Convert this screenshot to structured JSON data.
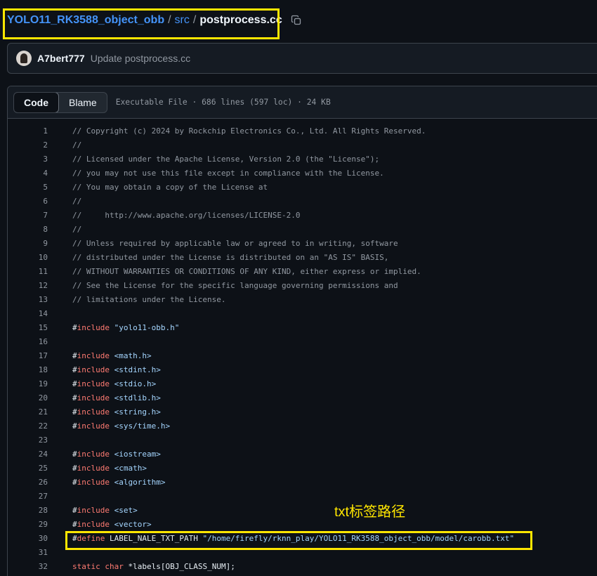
{
  "breadcrumb": {
    "repo": "YOLO11_RK3588_object_obb",
    "sep1": "/",
    "folder": "src",
    "sep2": "/",
    "file": "postprocess.cc"
  },
  "commit": {
    "author": "A7bert777",
    "message": "Update postprocess.cc"
  },
  "file_header": {
    "tab_code": "Code",
    "tab_blame": "Blame",
    "meta": "Executable File · 686 lines (597 loc) · 24 KB"
  },
  "code_lines": [
    {
      "n": "1",
      "t": [
        {
          "c": "c",
          "v": "// Copyright (c) 2024 by Rockchip Electronics Co., Ltd. All Rights Reserved."
        }
      ]
    },
    {
      "n": "2",
      "t": [
        {
          "c": "c",
          "v": "//"
        }
      ]
    },
    {
      "n": "3",
      "t": [
        {
          "c": "c",
          "v": "// Licensed under the Apache License, Version 2.0 (the \"License\");"
        }
      ]
    },
    {
      "n": "4",
      "t": [
        {
          "c": "c",
          "v": "// you may not use this file except in compliance with the License."
        }
      ]
    },
    {
      "n": "5",
      "t": [
        {
          "c": "c",
          "v": "// You may obtain a copy of the License at"
        }
      ]
    },
    {
      "n": "6",
      "t": [
        {
          "c": "c",
          "v": "//"
        }
      ]
    },
    {
      "n": "7",
      "t": [
        {
          "c": "c",
          "v": "//     http://www.apache.org/licenses/LICENSE-2.0"
        }
      ]
    },
    {
      "n": "8",
      "t": [
        {
          "c": "c",
          "v": "//"
        }
      ]
    },
    {
      "n": "9",
      "t": [
        {
          "c": "c",
          "v": "// Unless required by applicable law or agreed to in writing, software"
        }
      ]
    },
    {
      "n": "10",
      "t": [
        {
          "c": "c",
          "v": "// distributed under the License is distributed on an \"AS IS\" BASIS,"
        }
      ]
    },
    {
      "n": "11",
      "t": [
        {
          "c": "c",
          "v": "// WITHOUT WARRANTIES OR CONDITIONS OF ANY KIND, either express or implied."
        }
      ]
    },
    {
      "n": "12",
      "t": [
        {
          "c": "c",
          "v": "// See the License for the specific language governing permissions and"
        }
      ]
    },
    {
      "n": "13",
      "t": [
        {
          "c": "c",
          "v": "// limitations under the License."
        }
      ]
    },
    {
      "n": "14",
      "t": []
    },
    {
      "n": "15",
      "t": [
        {
          "c": "",
          "v": "#"
        },
        {
          "c": "k",
          "v": "include"
        },
        {
          "c": "",
          "v": " "
        },
        {
          "c": "s",
          "v": "\"yolo11-obb.h\""
        }
      ]
    },
    {
      "n": "16",
      "t": []
    },
    {
      "n": "17",
      "t": [
        {
          "c": "",
          "v": "#"
        },
        {
          "c": "k",
          "v": "include"
        },
        {
          "c": "",
          "v": " "
        },
        {
          "c": "s",
          "v": "<math.h>"
        }
      ]
    },
    {
      "n": "18",
      "t": [
        {
          "c": "",
          "v": "#"
        },
        {
          "c": "k",
          "v": "include"
        },
        {
          "c": "",
          "v": " "
        },
        {
          "c": "s",
          "v": "<stdint.h>"
        }
      ]
    },
    {
      "n": "19",
      "t": [
        {
          "c": "",
          "v": "#"
        },
        {
          "c": "k",
          "v": "include"
        },
        {
          "c": "",
          "v": " "
        },
        {
          "c": "s",
          "v": "<stdio.h>"
        }
      ]
    },
    {
      "n": "20",
      "t": [
        {
          "c": "",
          "v": "#"
        },
        {
          "c": "k",
          "v": "include"
        },
        {
          "c": "",
          "v": " "
        },
        {
          "c": "s",
          "v": "<stdlib.h>"
        }
      ]
    },
    {
      "n": "21",
      "t": [
        {
          "c": "",
          "v": "#"
        },
        {
          "c": "k",
          "v": "include"
        },
        {
          "c": "",
          "v": " "
        },
        {
          "c": "s",
          "v": "<string.h>"
        }
      ]
    },
    {
      "n": "22",
      "t": [
        {
          "c": "",
          "v": "#"
        },
        {
          "c": "k",
          "v": "include"
        },
        {
          "c": "",
          "v": " "
        },
        {
          "c": "s",
          "v": "<sys/time.h>"
        }
      ]
    },
    {
      "n": "23",
      "t": []
    },
    {
      "n": "24",
      "t": [
        {
          "c": "",
          "v": "#"
        },
        {
          "c": "k",
          "v": "include"
        },
        {
          "c": "",
          "v": " "
        },
        {
          "c": "s",
          "v": "<iostream>"
        }
      ]
    },
    {
      "n": "25",
      "t": [
        {
          "c": "",
          "v": "#"
        },
        {
          "c": "k",
          "v": "include"
        },
        {
          "c": "",
          "v": " "
        },
        {
          "c": "s",
          "v": "<cmath>"
        }
      ]
    },
    {
      "n": "26",
      "t": [
        {
          "c": "",
          "v": "#"
        },
        {
          "c": "k",
          "v": "include"
        },
        {
          "c": "",
          "v": " "
        },
        {
          "c": "s",
          "v": "<algorithm>"
        }
      ]
    },
    {
      "n": "27",
      "t": []
    },
    {
      "n": "28",
      "t": [
        {
          "c": "",
          "v": "#"
        },
        {
          "c": "k",
          "v": "include"
        },
        {
          "c": "",
          "v": " "
        },
        {
          "c": "s",
          "v": "<set>"
        }
      ]
    },
    {
      "n": "29",
      "t": [
        {
          "c": "",
          "v": "#"
        },
        {
          "c": "k",
          "v": "include"
        },
        {
          "c": "",
          "v": " "
        },
        {
          "c": "s",
          "v": "<vector>"
        }
      ]
    },
    {
      "n": "30",
      "t": [
        {
          "c": "",
          "v": "#"
        },
        {
          "c": "k",
          "v": "define"
        },
        {
          "c": "",
          "v": " LABEL_NALE_TXT_PATH "
        },
        {
          "c": "s",
          "v": "\"/home/firefly/rknn_play/YOLO11_RK3588_object_obb/model/carobb.txt\""
        }
      ]
    },
    {
      "n": "31",
      "t": []
    },
    {
      "n": "32",
      "t": [
        {
          "c": "k",
          "v": "static"
        },
        {
          "c": "",
          "v": " "
        },
        {
          "c": "k",
          "v": "char"
        },
        {
          "c": "",
          "v": " *labels[OBJ_CLASS_NUM];"
        }
      ]
    }
  ],
  "annotation": {
    "label": "txt标签路径",
    "color": "#ffe600"
  }
}
